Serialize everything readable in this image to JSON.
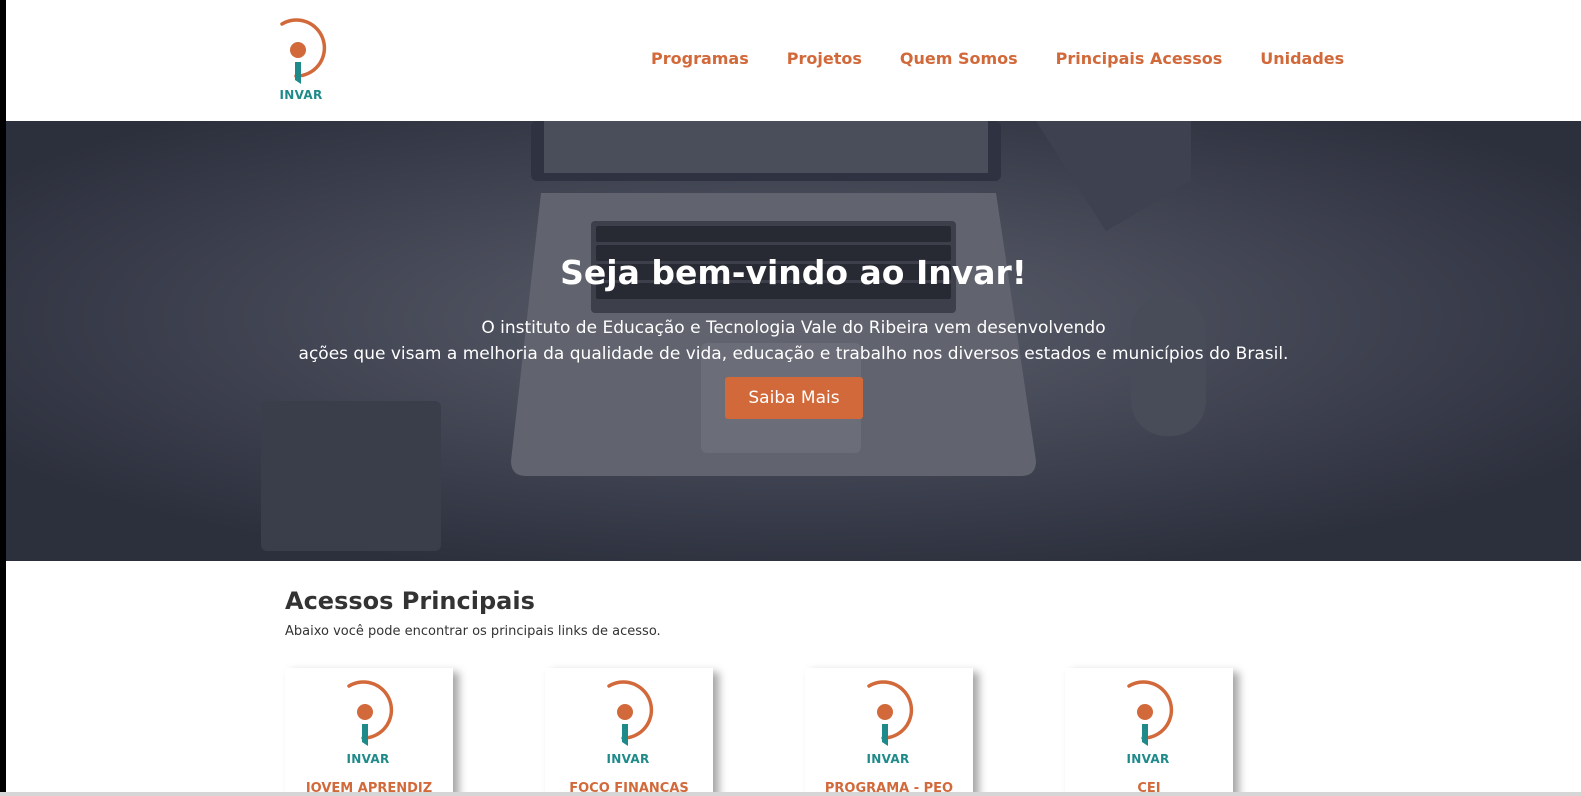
{
  "brand": {
    "logo_text": "INVAR",
    "accent_color": "#d2693a",
    "teal_color": "#1f8a8a"
  },
  "nav": {
    "items": [
      {
        "label": "Programas"
      },
      {
        "label": "Projetos"
      },
      {
        "label": "Quem Somos"
      },
      {
        "label": "Principais Acessos"
      },
      {
        "label": "Unidades"
      }
    ]
  },
  "hero": {
    "title": "Seja bem-vindo ao Invar!",
    "line1": "O instituto de Educação e Tecnologia Vale do Ribeira vem desenvolvendo",
    "line2": "ações que visam a melhoria da qualidade de vida, educação e trabalho nos diversos estados e municípios do Brasil.",
    "button_label": "Saiba Mais"
  },
  "access": {
    "title": "Acessos Principais",
    "subtitle": "Abaixo você pode encontrar os principais links de acesso.",
    "cards": [
      {
        "logo_text": "INVAR",
        "label": "JOVEM APRENDIZ"
      },
      {
        "logo_text": "INVAR",
        "label": "FOCO FINANÇAS"
      },
      {
        "logo_text": "INVAR",
        "label": "PROGRAMA - PEO"
      },
      {
        "logo_text": "INVAR",
        "label": "CEI"
      }
    ]
  }
}
